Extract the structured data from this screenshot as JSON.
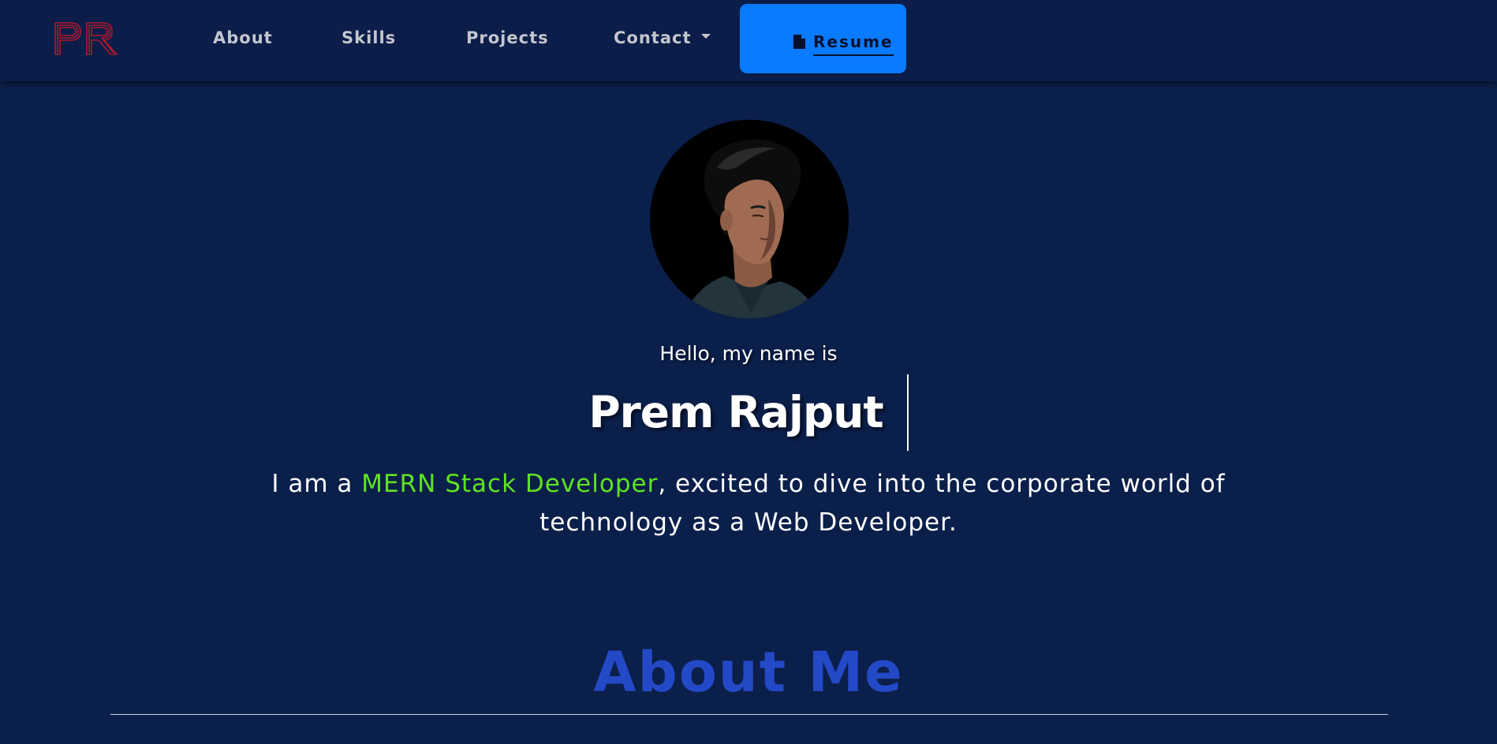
{
  "colors": {
    "background": "#0b1f4b",
    "navbar": "#0b1d48",
    "accent_blue": "#0a7aff",
    "highlight_green": "#5fe320",
    "heading_blue": "#2449c6",
    "logo_red": "#b0182e"
  },
  "logo": {
    "text": "PR",
    "icon": "pr-monogram-logo"
  },
  "nav": {
    "about": "About",
    "skills": "Skills",
    "projects": "Projects",
    "contact": "Contact",
    "resume": "Resume",
    "resume_icon": "file-icon",
    "contact_icon": "caret-down-icon"
  },
  "hero": {
    "avatar_alt": "profile-photo",
    "greeting": "Hello, my name is",
    "name": "Prem Rajput",
    "tagline_prefix": "I am a ",
    "tagline_highlight": "MERN Stack Developer",
    "tagline_suffix": ", excited to dive into the corporate world of technology as a Web Developer."
  },
  "about": {
    "title": "About Me"
  }
}
